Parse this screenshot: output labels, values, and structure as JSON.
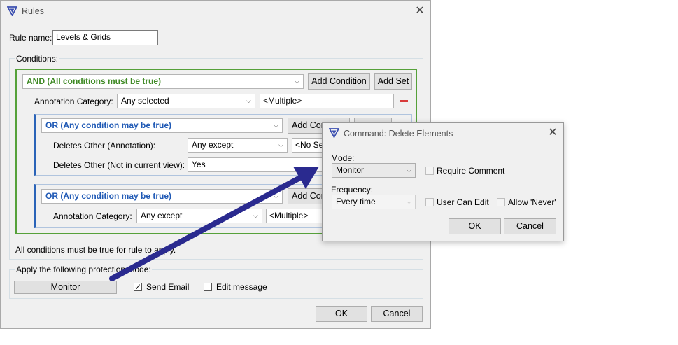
{
  "rules_window": {
    "title": "Rules",
    "rule_name_label": "Rule name:",
    "rule_name_value": "Levels & Grids",
    "conditions_label": "Conditions:",
    "and_set": {
      "label": "AND (All conditions must be true)",
      "add_condition": "Add Condition",
      "add_set": "Add Set",
      "condition_label": "Annotation Category:",
      "condition_op": "Any selected",
      "condition_value": "<Multiple>"
    },
    "or_set_1": {
      "label": "OR (Any condition may be true)",
      "add_condition": "Add Con",
      "row1_label": "Deletes Other (Annotation):",
      "row1_op": "Any except",
      "row1_value": "<No Se",
      "row2_label": "Deletes Other (Not in current view):",
      "row2_op": "Yes"
    },
    "or_set_2": {
      "label": "OR (Any condition may be true)",
      "add_condition": "Add Con",
      "row1_label": "Annotation Category:",
      "row1_op": "Any except",
      "row1_value": "<Multiple>"
    },
    "summary": "All conditions must be true for rule to apply.",
    "protection_label": "Apply the following protection mode:",
    "mode_button": "Monitor",
    "send_email_label": "Send Email",
    "send_email_checked": true,
    "edit_message_label": "Edit message",
    "ok": "OK",
    "cancel": "Cancel"
  },
  "command_dialog": {
    "title": "Command: Delete Elements",
    "mode_label": "Mode:",
    "mode_value": "Monitor",
    "require_comment_label": "Require Comment",
    "frequency_label": "Frequency:",
    "frequency_value": "Every time",
    "user_can_edit_label": "User Can Edit",
    "allow_never_label": "Allow 'Never'",
    "ok": "OK",
    "cancel": "Cancel"
  },
  "colors": {
    "and_green": "#3f8a25",
    "or_blue": "#1f59b5",
    "arrow": "#2a2a8f",
    "remove_red": "#d83b3b"
  },
  "icons": [
    "app-logo-icon",
    "close-icon",
    "chevron-down-icon",
    "remove-icon",
    "checkmark-icon",
    "arrow-annotation"
  ]
}
